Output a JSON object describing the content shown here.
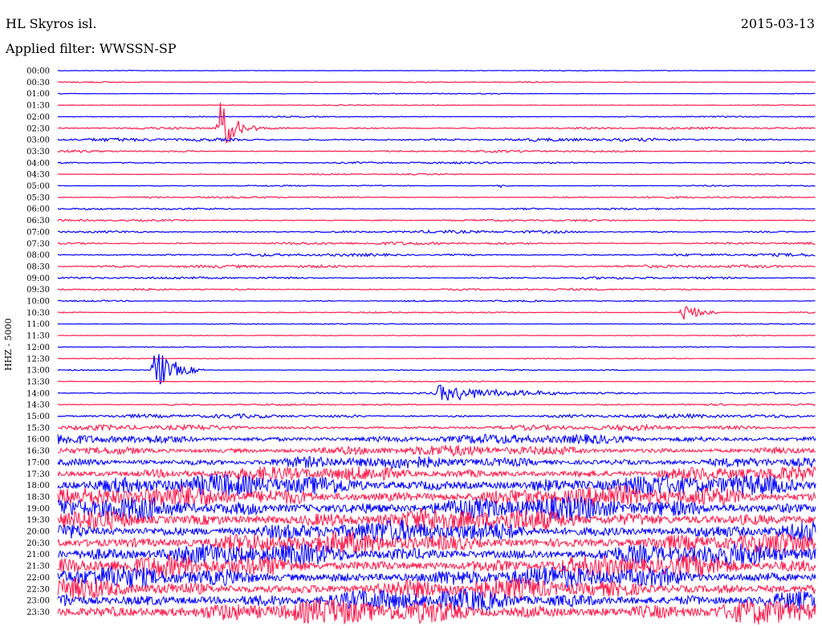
{
  "header": {
    "station": "HL Skyros isl.",
    "date": "2015-03-13",
    "filter": "Applied filter: WWSSN-SP"
  },
  "chart_data": {
    "type": "line",
    "title": "HL Skyros isl.",
    "date": "2015-03-13",
    "filter": "WWSSN-SP",
    "ylabel": "HHZ - 5000",
    "colors": [
      "#0000ff",
      "#ff1a4b"
    ],
    "minutes_per_trace": 30,
    "rows": [
      {
        "label": "00:00",
        "noise": 0.4
      },
      {
        "label": "00:30",
        "noise": 0.7
      },
      {
        "label": "01:00",
        "noise": 0.5
      },
      {
        "label": "01:30",
        "noise": 0.5
      },
      {
        "label": "02:00",
        "noise": 0.7
      },
      {
        "label": "02:30",
        "noise": 1.3
      },
      {
        "label": "03:00",
        "noise": 1.8
      },
      {
        "label": "03:30",
        "noise": 1.2
      },
      {
        "label": "04:00",
        "noise": 1.1
      },
      {
        "label": "04:30",
        "noise": 0.7
      },
      {
        "label": "05:00",
        "noise": 0.7
      },
      {
        "label": "05:30",
        "noise": 1.0
      },
      {
        "label": "06:00",
        "noise": 1.0
      },
      {
        "label": "06:30",
        "noise": 1.1
      },
      {
        "label": "07:00",
        "noise": 1.6
      },
      {
        "label": "07:30",
        "noise": 1.6
      },
      {
        "label": "08:00",
        "noise": 1.6
      },
      {
        "label": "08:30",
        "noise": 1.6
      },
      {
        "label": "09:00",
        "noise": 1.3
      },
      {
        "label": "09:30",
        "noise": 1.1
      },
      {
        "label": "10:00",
        "noise": 0.9
      },
      {
        "label": "10:30",
        "noise": 0.8
      },
      {
        "label": "11:00",
        "noise": 0.6
      },
      {
        "label": "11:30",
        "noise": 0.5
      },
      {
        "label": "12:00",
        "noise": 0.5
      },
      {
        "label": "12:30",
        "noise": 0.5
      },
      {
        "label": "13:00",
        "noise": 0.7
      },
      {
        "label": "13:30",
        "noise": 0.7
      },
      {
        "label": "14:00",
        "noise": 1.0
      },
      {
        "label": "14:30",
        "noise": 1.0
      },
      {
        "label": "15:00",
        "noise": 2.2
      },
      {
        "label": "15:30",
        "noise": 3.0
      },
      {
        "label": "16:00",
        "noise": 5.5
      },
      {
        "label": "16:30",
        "noise": 6.0
      },
      {
        "label": "17:00",
        "noise": 7.0
      },
      {
        "label": "17:30",
        "noise": 8.0
      },
      {
        "label": "18:00",
        "noise": 12.0
      },
      {
        "label": "18:30",
        "noise": 12.0
      },
      {
        "label": "19:00",
        "noise": 13.0
      },
      {
        "label": "19:30",
        "noise": 13.0
      },
      {
        "label": "20:00",
        "noise": 12.0
      },
      {
        "label": "20:30",
        "noise": 12.0
      },
      {
        "label": "21:00",
        "noise": 12.0
      },
      {
        "label": "21:30",
        "noise": 12.0
      },
      {
        "label": "22:00",
        "noise": 12.0
      },
      {
        "label": "22:30",
        "noise": 12.0
      },
      {
        "label": "23:00",
        "noise": 12.0
      },
      {
        "label": "23:30",
        "noise": 14.0
      }
    ],
    "events": [
      {
        "row": "02:30",
        "minute": 6.4,
        "amplitude": 40,
        "duration_min": 1.5
      },
      {
        "row": "05:00",
        "minute": 17.5,
        "amplitude": 4,
        "duration_min": 0.6
      },
      {
        "row": "10:30",
        "minute": 24.7,
        "amplitude": 20,
        "duration_min": 1.5
      },
      {
        "row": "13:00",
        "minute": 3.8,
        "amplitude": 40,
        "duration_min": 2.0
      },
      {
        "row": "14:00",
        "minute": 15.0,
        "amplitude": 12,
        "duration_min": 8.0
      }
    ]
  }
}
